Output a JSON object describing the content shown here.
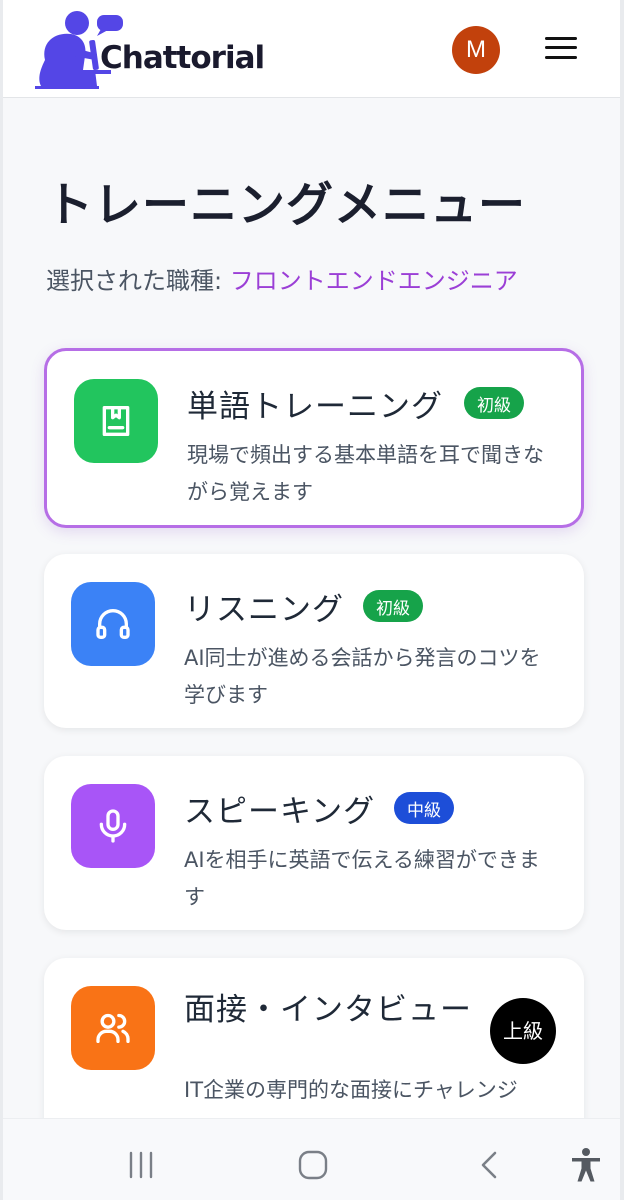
{
  "app": {
    "name": "Chattorial"
  },
  "header": {
    "avatar_initial": "M"
  },
  "page": {
    "title": "トレーニングメニュー",
    "selected_job_label": "選択された職種: ",
    "selected_job_value": "フロントエンドエンジニア"
  },
  "cards": [
    {
      "title": "単語トレーニング",
      "badge": "初級",
      "description": "現場で頻出する基本単語を耳で聞きながら覚えます",
      "icon": "book-icon",
      "color": "#22c55e",
      "selected": true
    },
    {
      "title": "リスニング",
      "badge": "初級",
      "description": "AI同士が進める会話から発言のコツを学びます",
      "icon": "headphones-icon",
      "color": "#3b82f6",
      "selected": false
    },
    {
      "title": "スピーキング",
      "badge": "中級",
      "description": "AIを相手に英語で伝える練習ができます",
      "icon": "microphone-icon",
      "color": "#a855f7",
      "selected": false
    },
    {
      "title": "面接・インタビュー",
      "badge": "上級",
      "description": "IT企業の専門的な面接にチャレンジ",
      "icon": "users-icon",
      "color": "#f97316",
      "selected": false
    }
  ],
  "colors": {
    "accent_purple": "#9b3fd6",
    "badge_green": "#16a34a",
    "badge_blue": "#1d4ed8",
    "badge_black": "#000000"
  },
  "system_nav": [
    "recent-apps-icon",
    "home-icon",
    "back-icon",
    "accessibility-icon"
  ]
}
